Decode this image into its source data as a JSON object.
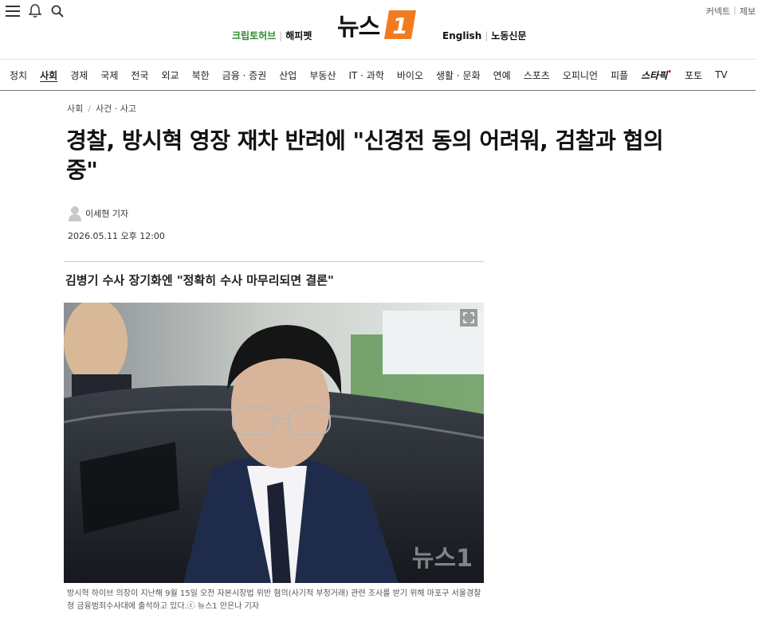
{
  "header": {
    "partners_left": [
      "크립토허브",
      "해피펫"
    ],
    "partners_right": [
      "English",
      "노동신문"
    ],
    "logo_text": "뉴스",
    "logo_number": "1",
    "top_right": [
      "커넥트",
      "제보"
    ],
    "icons": [
      "menu-icon",
      "bell-icon",
      "search-icon"
    ]
  },
  "nav": {
    "items": [
      "정치",
      "사회",
      "경제",
      "국제",
      "전국",
      "외교",
      "북한",
      "금융 · 증권",
      "산업",
      "부동산",
      "IT · 과학",
      "바이오",
      "생활 · 문화",
      "연예",
      "스포츠",
      "오피니언",
      "피플",
      "스타픽",
      "포토",
      "TV"
    ],
    "active": "사회"
  },
  "article": {
    "breadcrumb": [
      "사회",
      "사건 · 사고"
    ],
    "headline": "경찰, 방시혁 영장 재차 반려에 \"신경전 동의 어려워, 검찰과 협의 중\"",
    "byline": "이세현 기자",
    "date": "2026.05.11 오후 12:00",
    "subhead": "김병기 수사 장기화엔 \"정확히 수사 마무리되면 결론\"",
    "photo_watermark": "뉴스1",
    "caption": "방시혁 하이브 의장이 지난해 9월 15일 오전 자본시장법 위반 혐의(사기적 부정거래) 관련 조사를 받기 위해 마포구 서울경찰청 금융범죄수사대에 출석하고 있다.ⓒ 뉴스1 안은나 기자"
  },
  "colors": {
    "brand_orange": "#f47a20",
    "partner_green": "#2e8b2e",
    "starpick_pink": "#e6007e"
  }
}
